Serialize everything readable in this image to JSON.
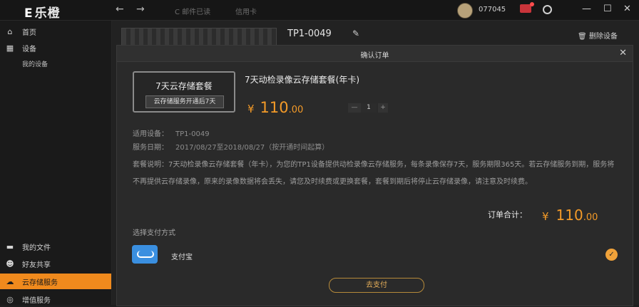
{
  "app": {
    "logo_icon": "E",
    "logo_text": "乐橙"
  },
  "topbar": {
    "back_icon": "←",
    "forward_icon": "→",
    "link1": "C  邮件已读",
    "link2": "信用卡",
    "user_id": "077045"
  },
  "sidebar": {
    "items": [
      {
        "icon": "home-icon",
        "glyph": "⌂",
        "label": "首页"
      },
      {
        "icon": "device-icon",
        "glyph": "▦",
        "label": "设备"
      },
      {
        "label": "我的设备"
      },
      {
        "icon": "folder-icon",
        "glyph": "▬",
        "label": "我的文件"
      },
      {
        "icon": "friends-icon",
        "glyph": "☻",
        "label": "好友共享"
      },
      {
        "icon": "cloud-icon",
        "glyph": "☁",
        "label": "云存储服务"
      },
      {
        "icon": "service-icon",
        "glyph": "◎",
        "label": "增值服务"
      }
    ]
  },
  "device": {
    "id": "TP1-0049",
    "delete_label": "删除设备"
  },
  "dialog": {
    "title": "确认订单",
    "close": "✕",
    "card_top": "7天云存储套餐",
    "card_bottom": "云存储服务开通后7天",
    "product_name": "7天动检录像云存储套餐(年卡)",
    "price_symbol": "¥",
    "price_int": "110",
    "price_dec": ".00",
    "qty_minus": "—",
    "qty": "1",
    "qty_plus": "+",
    "info1_label": "适用设备：",
    "info1_value": "TP1-0049",
    "info2_label": "服务日期：",
    "info2_value": "2017/08/27至2018/08/27（按开通时间起算）",
    "description": "套餐说明：7天动检录像云存储套餐（年卡），为您的TP1设备提供动检录像云存储服务，每条录像保存7天，服务期限365天。若云存储服务到期，服务将不再提供云存储录像，原来的录像数据将会丢失，请您及时续费或更换套餐，套餐到期后将停止云存储录像，请注意及时续费。",
    "total_label": "订单合计：",
    "total_symbol": "¥",
    "total_int": "110",
    "total_dec": ".00",
    "pay_method_label": "选择支付方式",
    "pay_method_name": "支付宝",
    "pay_button": "去支付"
  },
  "colors": {
    "accent": "#f08a1d",
    "price": "#f39a28",
    "alipay": "#3a8fe0"
  }
}
